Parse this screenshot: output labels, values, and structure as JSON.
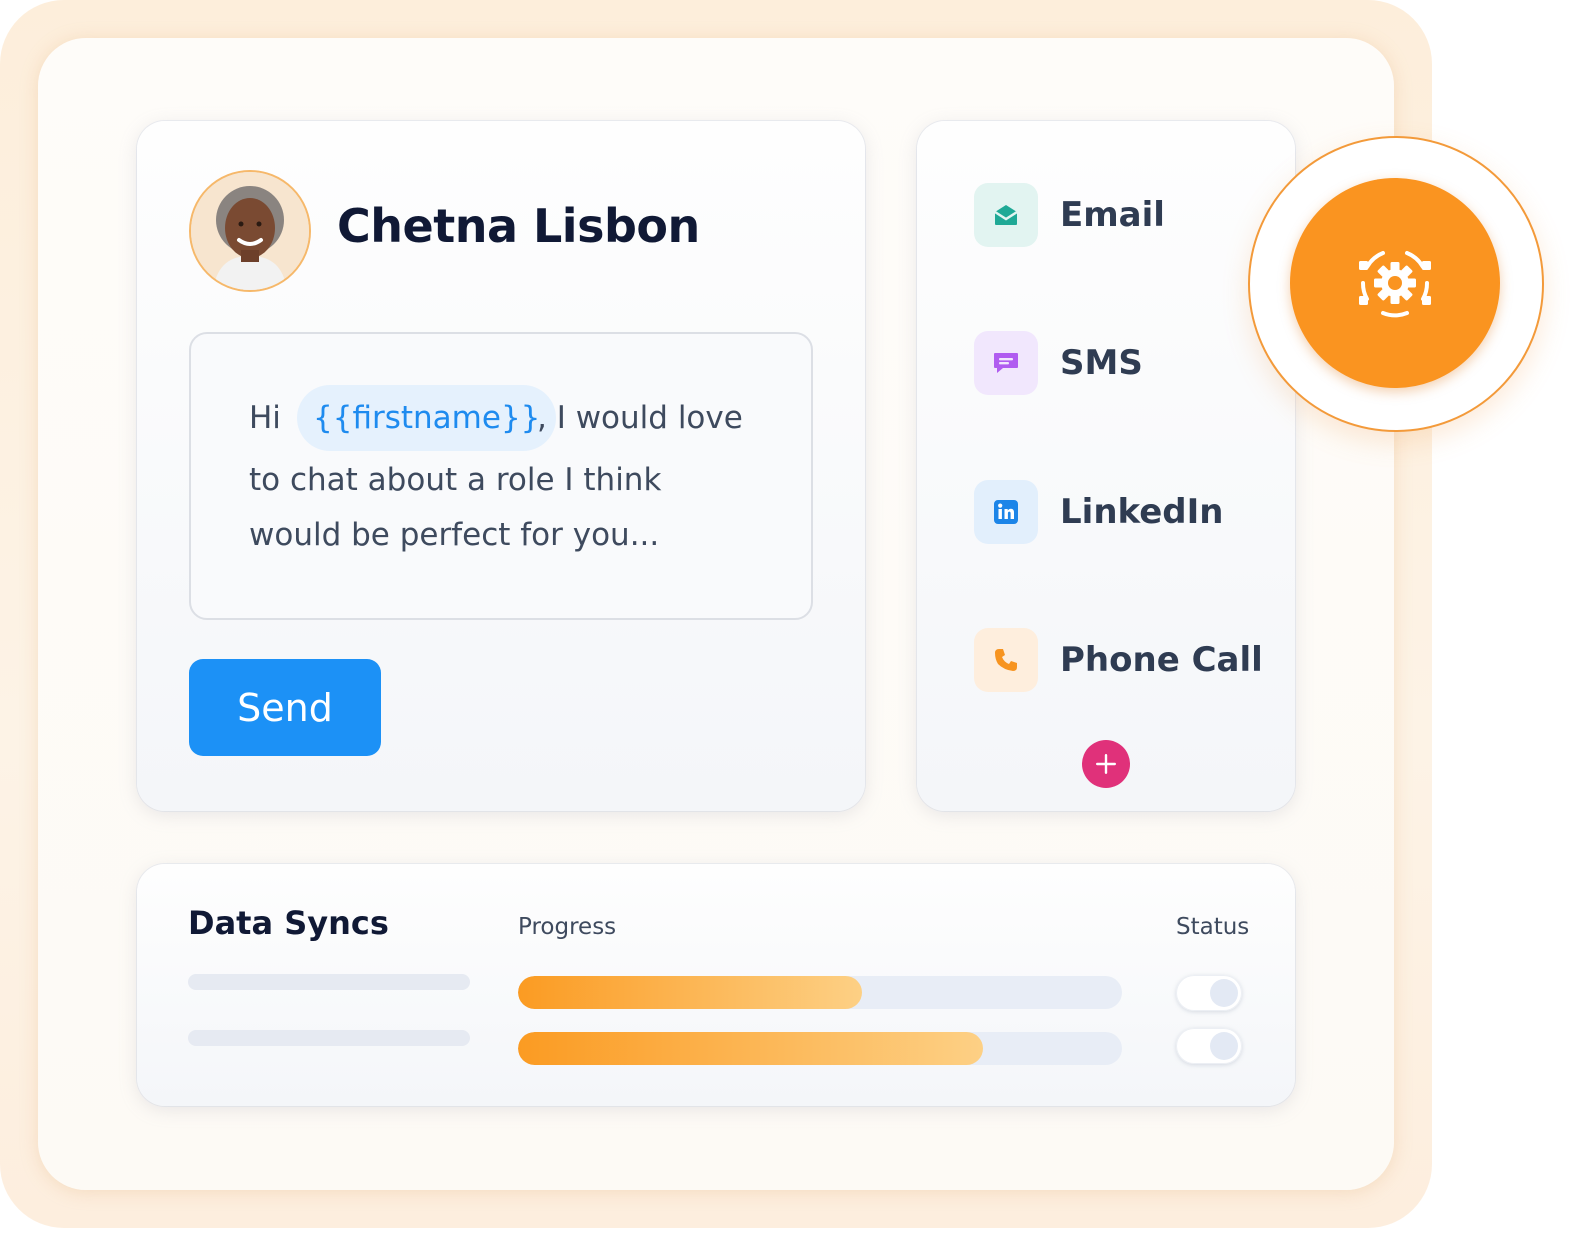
{
  "contact": {
    "name": "Chetna Lisbon",
    "avatar_icon": "person-avatar"
  },
  "message": {
    "greeting": "Hi",
    "variable_token": "{{firstname}}",
    "after_token": ", I would love",
    "line2": "to chat about a role I think",
    "line3": "would be perfect for you..."
  },
  "send_button": {
    "label": "Send",
    "color": "#1c91f6"
  },
  "channels": [
    {
      "label": "Email",
      "icon": "email-icon",
      "color": "#1fa996",
      "bg": "#e2f4f1"
    },
    {
      "label": "SMS",
      "icon": "sms-icon",
      "color": "#b05cf0",
      "bg": "#f1e7fd"
    },
    {
      "label": "LinkedIn",
      "icon": "linkedin-icon",
      "color": "#1c85e8",
      "bg": "#e2effc"
    },
    {
      "label": "Phone Call",
      "icon": "phone-icon",
      "color": "#f79420",
      "bg": "#feeedd"
    }
  ],
  "add_channel": {
    "icon": "plus-icon",
    "color": "#e0317a"
  },
  "settings_badge": {
    "icon": "gear-icon",
    "color": "#fa9420"
  },
  "data_syncs": {
    "title": "Data Syncs",
    "columns": {
      "progress": "Progress",
      "status": "Status"
    },
    "rows": [
      {
        "progress": 0.57,
        "status_on": false
      },
      {
        "progress": 0.77,
        "status_on": false
      }
    ]
  }
}
